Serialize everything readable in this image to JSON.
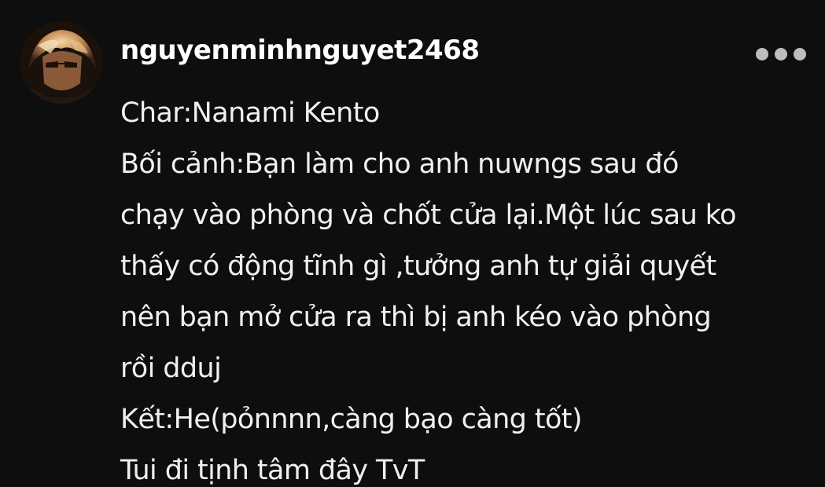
{
  "post": {
    "author": {
      "username": "nguyenminhnguyet2468"
    },
    "lines": [
      "Char:Nanami Kento",
      "Bối cảnh:Bạn làm cho anh nuwngs sau đó",
      "chạy vào phòng và chốt cửa lại.Một lúc sau ko",
      "thấy có động tĩnh gì ,tưởng anh tự giải quyết",
      "nên bạn mở cửa ra thì bị anh kéo vào phòng",
      "rồi dduj",
      "Kết:He(pỏnnnn,càng bạo càng tốt)",
      "Tui đi tịnh tâm đây TvT"
    ]
  },
  "icons": {
    "more": "more-horizontal-icon"
  },
  "colors": {
    "background": "#0e0e0e",
    "text": "#f0f0f0",
    "dots": "#bdbdbd"
  }
}
